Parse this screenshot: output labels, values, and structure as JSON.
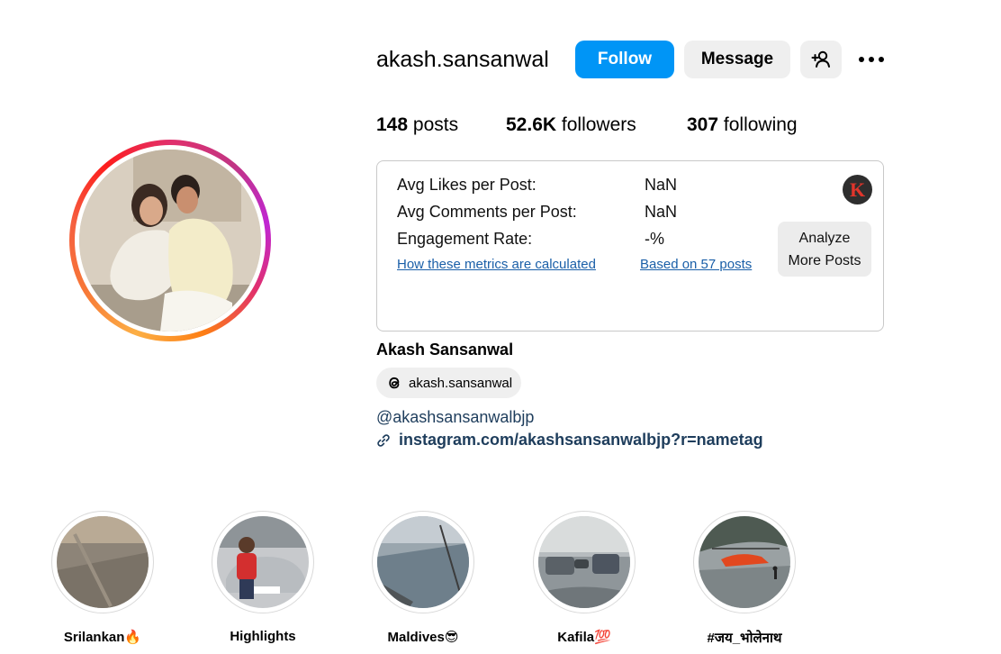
{
  "profile": {
    "username": "akash.sansanwal",
    "full_name": "Akash Sansanwal",
    "threads_handle": "akash.sansanwal",
    "bio_handle": "@akashsansanwalbjp",
    "bio_link": "instagram.com/akashsansanwalbjp?r=nametag"
  },
  "actions": {
    "follow_label": "Follow",
    "message_label": "Message",
    "add_user_icon": "add-user-icon",
    "more_icon": "more-options-icon"
  },
  "stats": {
    "posts_count": "148",
    "posts_label": "posts",
    "followers_count": "52.6K",
    "followers_label": "followers",
    "following_count": "307",
    "following_label": "following"
  },
  "metrics": {
    "avg_likes_label": "Avg Likes per Post:",
    "avg_likes_value": "NaN",
    "avg_comments_label": "Avg Comments per Post:",
    "avg_comments_value": "NaN",
    "engagement_label": "Engagement Rate:",
    "engagement_value": "-%",
    "how_calculated_link": "How these metrics are calculated",
    "based_on_link": "Based on 57 posts",
    "analyze_button": "Analyze More Posts",
    "badge_letter": "K"
  },
  "highlights": [
    {
      "label": "Srilankan🔥"
    },
    {
      "label": "Highlights"
    },
    {
      "label": "Maldives😎"
    },
    {
      "label": "Kafila💯"
    },
    {
      "label": "#जय_भोलेनाथ"
    }
  ],
  "colors": {
    "follow_blue": "#0095f6",
    "button_gray": "#efefef",
    "link_blue": "#1a5fa8",
    "bio_text": "#1e3d5c"
  }
}
